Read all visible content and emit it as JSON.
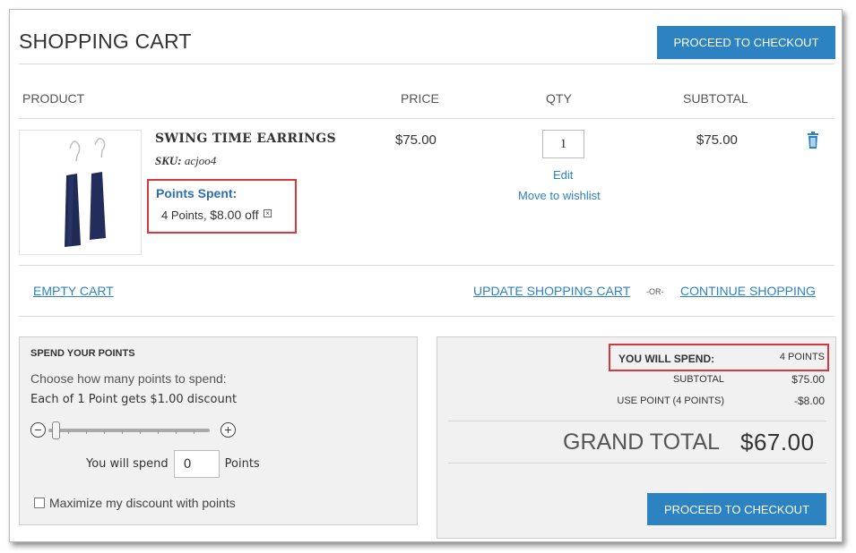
{
  "header": {
    "title": "SHOPPING CART",
    "checkout_label": "PROCEED TO CHECKOUT"
  },
  "table": {
    "columns": [
      "PRODUCT",
      "PRICE",
      "QTY",
      "SUBTOTAL"
    ]
  },
  "item": {
    "name": "SWING TIME EARRINGS",
    "sku_label": "SKU:",
    "sku_value": "acjoo4",
    "points_title": "Points Spent:",
    "points_text": "4 Points,",
    "points_amount": "$8.00 off",
    "price": "$75.00",
    "qty": "1",
    "edit_label": "Edit",
    "wishlist_label": "Move to wishlist",
    "subtotal": "$75.00",
    "trash_icon": "trash-icon",
    "image_icon": "earrings-product-image"
  },
  "actions": {
    "empty_cart": "EMPTY CART",
    "update_cart": "UPDATE SHOPPING CART",
    "or": "-OR-",
    "continue": "CONTINUE SHOPPING"
  },
  "spend": {
    "title": "SPEND YOUR POINTS",
    "description": "Choose how many points to spend:",
    "rule": "Each of 1 Point gets $1.00 discount",
    "minus": "−",
    "plus": "+",
    "slider_value": 0,
    "will_spend_label": "You will spend",
    "will_spend_value": "0",
    "points_label": "Points",
    "maximize_label": "Maximize my discount with points"
  },
  "totals": {
    "you_will_spend_label": "YOU WILL SPEND:",
    "you_will_spend_value": "4 POINTS",
    "subtotal_label": "SUBTOTAL",
    "subtotal_value": "$75.00",
    "use_point_label": "USE POINT (4 POINTS)",
    "use_point_value": "-$8.00",
    "grand_total_label": "GRAND TOTAL",
    "grand_total_value": "$67.00",
    "checkout_label": "PROCEED TO CHECKOUT"
  },
  "colors": {
    "accent": "#2d82c1",
    "highlight_border": "#d9383a",
    "points_title": "#2d6db5",
    "earring": "#1f2a55"
  }
}
